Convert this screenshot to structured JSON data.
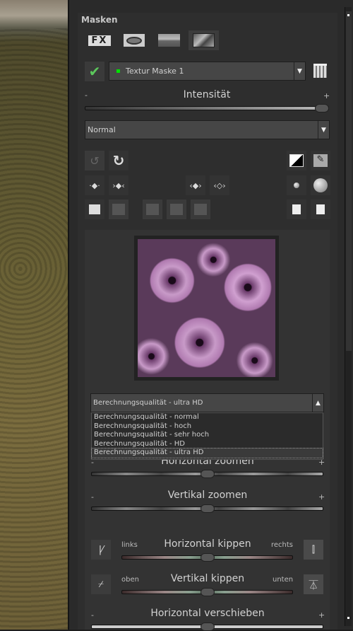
{
  "panel": {
    "title": "Masken"
  },
  "mask_tabs": [
    {
      "name": "fx",
      "label": "FX"
    },
    {
      "name": "filter"
    },
    {
      "name": "landscape"
    },
    {
      "name": "texture",
      "selected": true
    }
  ],
  "mask_select": {
    "value": "Textur Maske 1",
    "indicator_color": "#00e000",
    "enabled": true
  },
  "intensity": {
    "label": "Intensität",
    "minus": "-",
    "plus": "+",
    "value_percent": 100
  },
  "blend_mode": {
    "value": "Normal"
  },
  "quality": {
    "value": "Berechnungsqualität - ultra HD",
    "options": [
      "Berechnungsqualität - normal",
      "Berechnungsqualität - hoch",
      "Berechnungsqualität - sehr hoch",
      "Berechnungsqualität - HD",
      "Berechnungsqualität - ultra HD"
    ]
  },
  "sliders": {
    "h_zoom": {
      "label": "Horizontal zoomen",
      "minus": "-",
      "plus": "+",
      "value_percent": 50
    },
    "v_zoom": {
      "label": "Vertikal zoomen",
      "minus": "-",
      "plus": "+",
      "value_percent": 50
    },
    "h_flip": {
      "label": "Horizontal kippen",
      "left": "links",
      "right": "rechts",
      "value_percent": 50
    },
    "v_flip": {
      "label": "Vertikal kippen",
      "left": "oben",
      "right": "unten",
      "value_percent": 50
    },
    "h_shift": {
      "label": "Horizontal verschieben",
      "minus": "-",
      "plus": "+",
      "value_percent": 50
    }
  },
  "colors": {
    "accent_check": "#5cc85c",
    "background": "#2e2e2e"
  }
}
